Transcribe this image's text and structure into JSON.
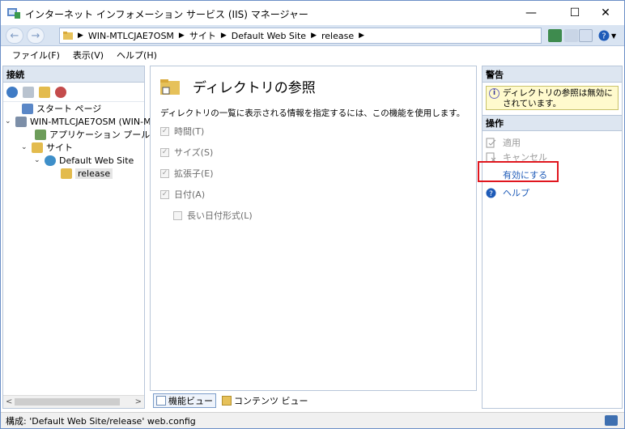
{
  "window": {
    "title": "インターネット インフォメーション サービス (IIS) マネージャー",
    "minimize": "—",
    "maximize": "☐",
    "close": "✕"
  },
  "address": {
    "back": "←",
    "forward": "→",
    "crumbs": [
      "WIN-MTLCJAE7OSM",
      "サイト",
      "Default Web Site",
      "release"
    ],
    "separator": "▶"
  },
  "menu": {
    "items": [
      "ファイル(F)",
      "表示(V)",
      "ヘルプ(H)"
    ]
  },
  "connections": {
    "header": "接続",
    "tree": [
      {
        "label": "スタート ページ",
        "expander": ""
      },
      {
        "label": "WIN-MTLCJAE7OSM (WIN-M",
        "expander": "⌄"
      },
      {
        "label": "アプリケーション プール",
        "expander": ""
      },
      {
        "label": "サイト",
        "expander": "⌄"
      },
      {
        "label": "Default Web Site",
        "expander": "⌄"
      },
      {
        "label": "release",
        "expander": ""
      }
    ],
    "scroll_left": "<",
    "scroll_right": ">"
  },
  "feature": {
    "title": "ディレクトリの参照",
    "description": "ディレクトリの一覧に表示される情報を指定するには、この機能を使用します。",
    "options": [
      {
        "label": "時間(T)",
        "checked": true
      },
      {
        "label": "サイズ(S)",
        "checked": true
      },
      {
        "label": "拡張子(E)",
        "checked": true
      },
      {
        "label": "日付(A)",
        "checked": true
      },
      {
        "label": "長い日付形式(L)",
        "checked": false
      }
    ],
    "check_mark": "✓"
  },
  "tabs": {
    "features_view": "機能ビュー",
    "content_view": "コンテンツ ビュー"
  },
  "actions": {
    "alert_header": "警告",
    "alert_text": "ディレクトリの参照は無効にされています。",
    "info_glyph": "i",
    "ops_header": "操作",
    "apply": "適用",
    "cancel": "キャンセル",
    "enable": "有効にする",
    "help": "ヘルプ",
    "help_glyph": "?"
  },
  "status": {
    "text": "構成: 'Default Web Site/release' web.config"
  },
  "colors": {
    "accent": "#1e5bb8",
    "highlight_box": "#e0161e",
    "panel_header": "#dde6f1"
  }
}
